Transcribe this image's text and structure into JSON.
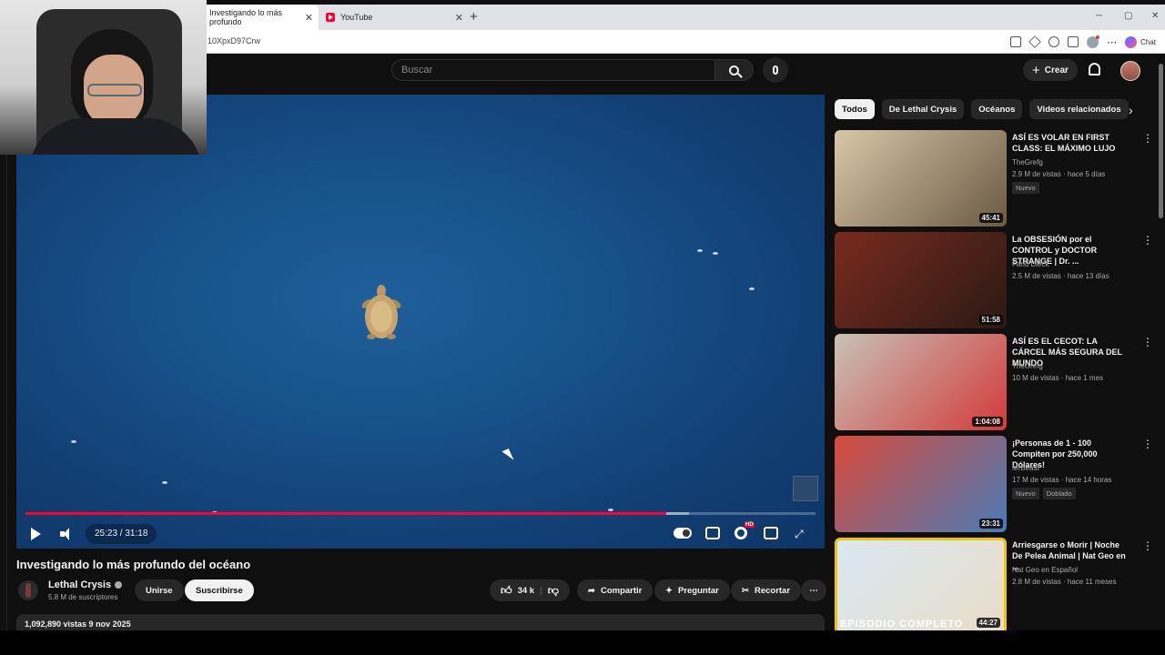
{
  "browser": {
    "tabs": [
      {
        "label": "Investigando lo más profundo",
        "active": true
      },
      {
        "label": "YouTube",
        "active": false
      }
    ],
    "url": "10XpxD97Crw",
    "chat_label": "Chat"
  },
  "header": {
    "search_placeholder": "Buscar",
    "create_label": "Crear"
  },
  "player": {
    "time": "25:23 / 31:18",
    "progress": 0.811,
    "buffered": 0.84,
    "hd_badge": "HD"
  },
  "video": {
    "title": "Investigando lo más profundo del océano",
    "channel": "Lethal Crysis",
    "subscribers": "5.8 M de suscriptores",
    "join_label": "Unirse",
    "subscribe_label": "Suscribirse",
    "likes": "34 k",
    "share_label": "Compartir",
    "ask_label": "Preguntar",
    "clip_label": "Recortar",
    "description": "1,092,890 vistas  9 nov 2025"
  },
  "sidebar": {
    "chips": [
      "Todos",
      "De Lethal Crysis",
      "Océanos",
      "Videos relacionados"
    ],
    "videos": [
      {
        "title": "ASÍ ES VOLAR EN FIRST CLASS: EL MÁXIMO LUJO",
        "channel": "TheGrefg",
        "meta": "2.9 M de vistas · hace 5 días",
        "duration": "45:41",
        "badges": [
          "Nuevo"
        ],
        "color1": "#d9c7a8",
        "color2": "#6b5a44"
      },
      {
        "title": "La OBSESIÓN por el CONTROL y DOCTOR STRANGE | Dr. ...",
        "channel": "Farid Dieck",
        "meta": "2.5 M de vistas · hace 13 días",
        "duration": "51:58",
        "badges": [],
        "color1": "#7a2a1e",
        "color2": "#2a1a14"
      },
      {
        "title": "ASÍ ES EL CECOT: LA CÁRCEL MÁS SEGURA DEL MUNDO",
        "channel": "TheGrefg",
        "meta": "10 M de vistas · hace 1 mes",
        "duration": "1:04:08",
        "badges": [],
        "color1": "#c9c2b8",
        "color2": "#d33a3a"
      },
      {
        "title": "¡Personas de 1 - 100 Compiten por 250,000 Dólares!",
        "channel": "MrBeast",
        "meta": "17 M de vistas · hace 14 horas",
        "duration": "23:31",
        "badges": [
          "Nuevo",
          "Doblado"
        ],
        "color1": "#d94a3c",
        "color2": "#4a7ab5"
      },
      {
        "title": "Arriesgarse o Morir | Noche De Pelea Animal | Nat Geo en ...",
        "channel": "Nat Geo en Español",
        "meta": "2.8 M de vistas · hace 11 meses",
        "duration": "44:27",
        "badges": [],
        "overlay": "EPISODIO COMPLETO",
        "color1": "#d9e8f2",
        "color2": "#e8ddc8"
      }
    ]
  }
}
